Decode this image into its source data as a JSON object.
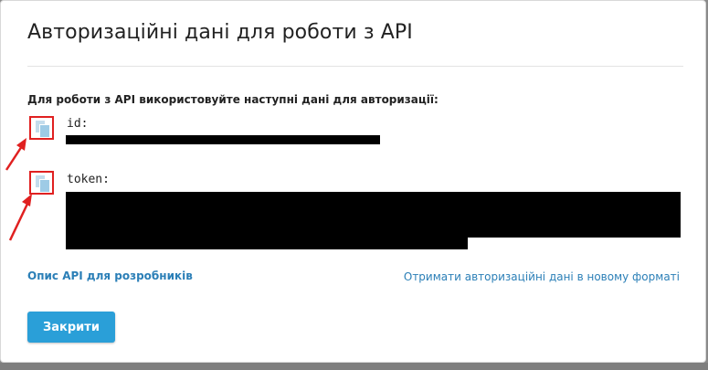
{
  "dialog": {
    "title": "Авторизаційні дані для роботи з API",
    "intro": "Для роботи з API використовуйте наступні дані для авторизації:",
    "fields": [
      {
        "label": "id:"
      },
      {
        "label": "token:"
      }
    ],
    "links": {
      "developers": "Опис API для розробників",
      "new_format": "Отримати авторизаційні дані в новому форматі"
    },
    "close_label": "Закрити",
    "copy_icon": "copy-icon"
  },
  "colors": {
    "accent": "#2a9fd8",
    "link": "#2b7fb7",
    "highlight": "#e02020"
  }
}
